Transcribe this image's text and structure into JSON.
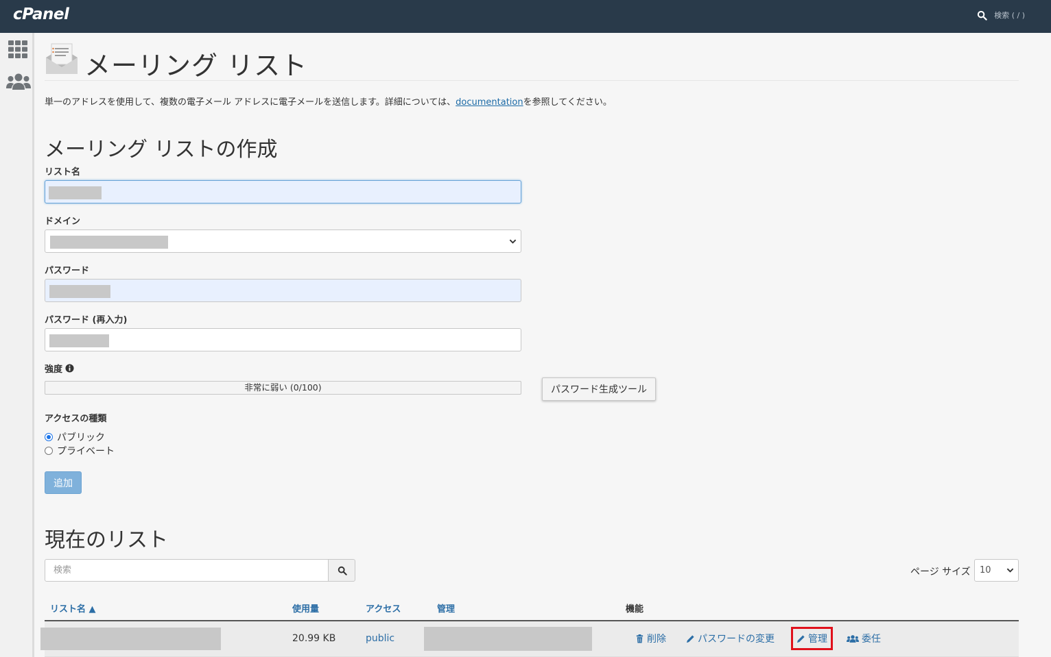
{
  "app": {
    "logo": "cPanel"
  },
  "topbar": {
    "search_placeholder": "検索 ( / )"
  },
  "page": {
    "title": "メーリング リスト",
    "intro_before": "単一のアドレスを使用して、複数の電子メール アドレスに電子メールを送信します。詳細については、",
    "intro_link": "documentation",
    "intro_after": "を参照してください。"
  },
  "create": {
    "title": "メーリング リストの作成",
    "list_name_label": "リスト名",
    "domain_label": "ドメイン",
    "password_label": "パスワード",
    "password_confirm_label": "パスワード (再入力)",
    "strength_label": "強度",
    "strength_text": "非常に弱い (0/100)",
    "strength_value": 0,
    "generator_button": "パスワード生成ツール",
    "access_label": "アクセスの種類",
    "access_options": [
      "パブリック",
      "プライベート"
    ],
    "access_selected": "パブリック",
    "add_button": "追加"
  },
  "lists": {
    "title": "現在のリスト",
    "search_placeholder": "検索",
    "page_size_label": "ページ サイズ",
    "page_size_value": "10",
    "columns": [
      "リスト名 ▲",
      "使用量",
      "アクセス",
      "管理",
      "機能"
    ],
    "rows": [
      {
        "usage": "20.99 KB",
        "access": "public",
        "actions": [
          "削除",
          "パスワードの変更",
          "管理",
          "委任"
        ]
      }
    ]
  },
  "colors": {
    "topbar": "#293a4a",
    "link": "#2c6ea6",
    "highlight": "#e0101b",
    "primary_button": "#7fb1db"
  }
}
